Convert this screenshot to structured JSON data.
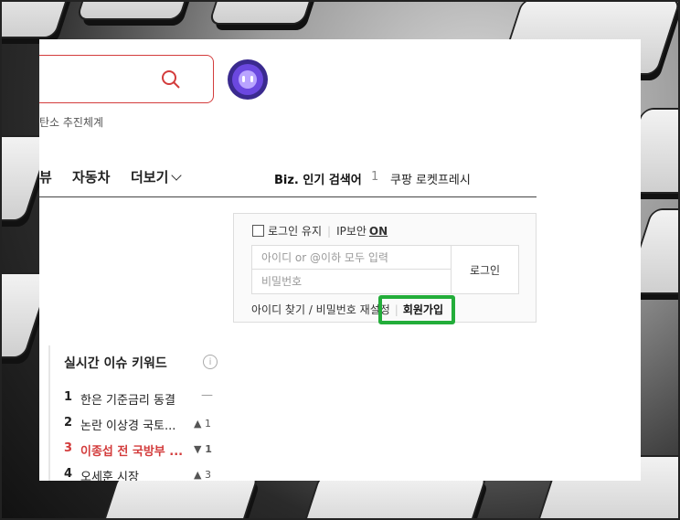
{
  "header": {
    "subtitle": "탄소 추진체계"
  },
  "nav": {
    "items": [
      "뷰",
      "자동차",
      "더보기"
    ],
    "biz_label": "Biz. 인기 검색어",
    "biz_rank_num": "1",
    "biz_rank_keyword": "쿠팡 로켓프레시"
  },
  "login": {
    "keep_label": "로그인 유지",
    "ip_label": "IP보안",
    "ip_state": "ON",
    "id_placeholder": "아이디 or @이하 모두 입력",
    "pw_placeholder": "비밀번호",
    "login_button": "로그인",
    "find_link": "아이디 찾기 / 비밀번호 재설정",
    "join_link": "회원가입"
  },
  "issue": {
    "title": "실시간 이슈 키워드",
    "info": "i",
    "rows": [
      {
        "rank": "1",
        "keyword": "한은 기준금리 동결",
        "change": "—"
      },
      {
        "rank": "2",
        "keyword": "논란 이상경 국토...",
        "change": "▲ 1"
      },
      {
        "rank": "3",
        "keyword": "이종섭 전 국방부 ...",
        "change": "▼ 1"
      },
      {
        "rank": "4",
        "keyword": "오세훈 시장",
        "change": "▲ 3"
      }
    ]
  },
  "colors": {
    "accent_red": "#d33c3c",
    "highlight_green": "#23ad3a",
    "up_orange": "#f08c1b",
    "down_blue": "#5a8bd6"
  }
}
